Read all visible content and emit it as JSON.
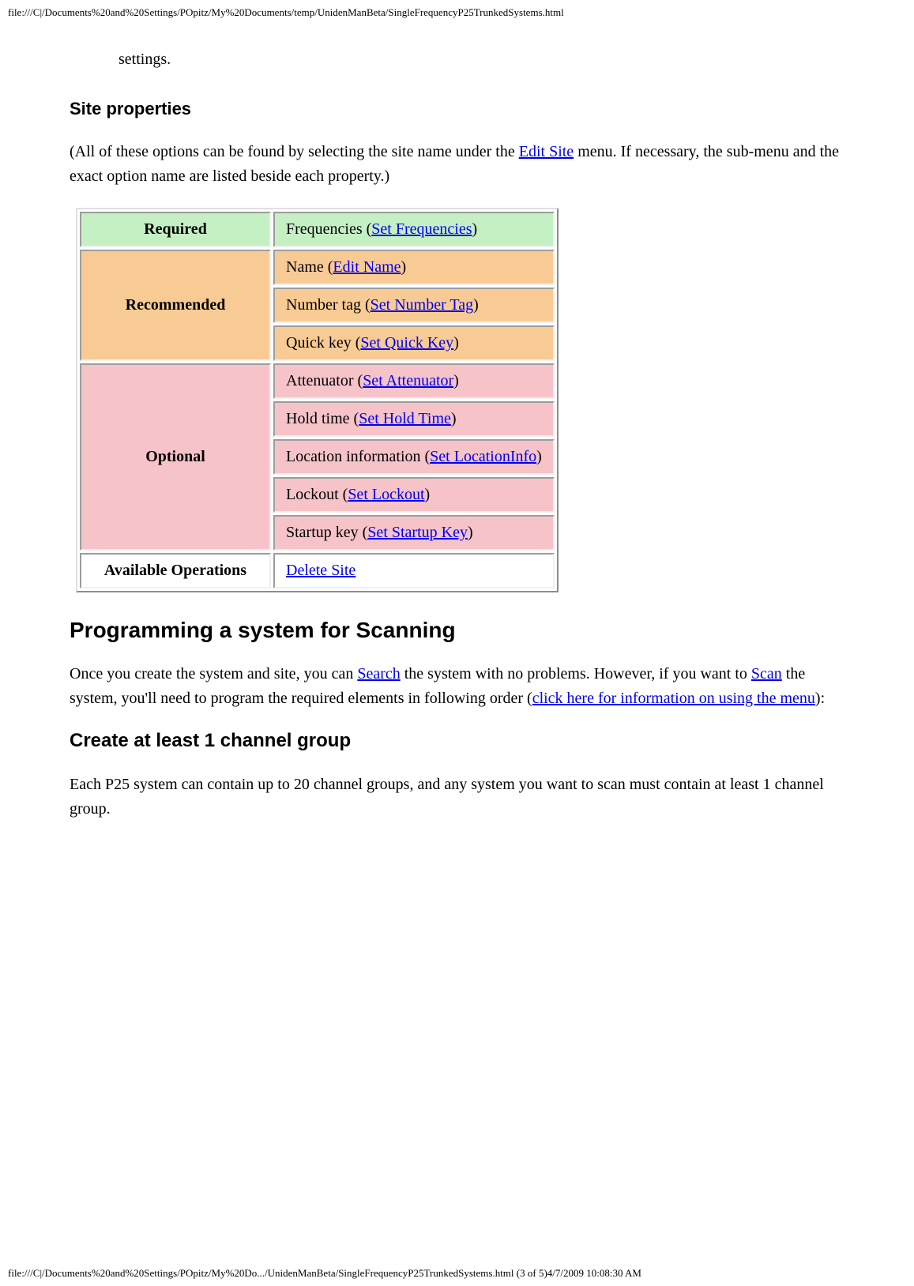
{
  "path_top": "file:///C|/Documents%20and%20Settings/POpitz/My%20Documents/temp/UnidenManBeta/SingleFrequencyP25TrunkedSystems.html",
  "intro_fragment": "settings.",
  "h_site_properties": "Site properties",
  "p_intro_before": "(All of these options can be found by selecting the site name under the ",
  "p_intro_link": "Edit Site",
  "p_intro_after": " menu. If necessary, the sub-menu and the exact option name are listed beside each property.)",
  "table": {
    "required_label": "Required",
    "required_row": {
      "before": "Frequencies (",
      "link": "Set Frequencies",
      "after": ")"
    },
    "recommended_label": "Recommended",
    "recommended_rows": [
      {
        "before": "Name (",
        "link": "Edit Name",
        "after": ")"
      },
      {
        "before": "Number tag (",
        "link": "Set Number Tag",
        "after": ")"
      },
      {
        "before": "Quick key (",
        "link": "Set Quick Key",
        "after": ")"
      }
    ],
    "optional_label": "Optional",
    "optional_rows": [
      {
        "before": "Attenuator (",
        "link": "Set Attenuator",
        "after": ")"
      },
      {
        "before": "Hold time (",
        "link": "Set Hold Time",
        "after": ")"
      },
      {
        "before": "Location information (",
        "link": "Set LocationInfo",
        "after": ")"
      },
      {
        "before": "Lockout (",
        "link": "Set Lockout",
        "after": ")"
      },
      {
        "before": "Startup key (",
        "link": "Set Startup Key",
        "after": ")"
      }
    ],
    "avail_ops_label": "Available Operations",
    "avail_ops_link": "Delete Site"
  },
  "h_programming": "Programming a system for Scanning",
  "p2": {
    "s1": "Once you create the system and site, you can ",
    "l1": "Search",
    "s2": " the system with no problems. However, if you want to ",
    "l2": "Scan",
    "s3": " the system, you'll need to program the required elements in following order (",
    "l3": "click here for information on using the menu",
    "s4": "):"
  },
  "h_create_group": "Create at least 1 channel group",
  "p3": "Each P25 system can contain up to 20 channel groups, and any system you want to scan must contain at least 1 channel group.",
  "footer": "file:///C|/Documents%20and%20Settings/POpitz/My%20Do.../UnidenManBeta/SingleFrequencyP25TrunkedSystems.html (3 of 5)4/7/2009 10:08:30 AM"
}
